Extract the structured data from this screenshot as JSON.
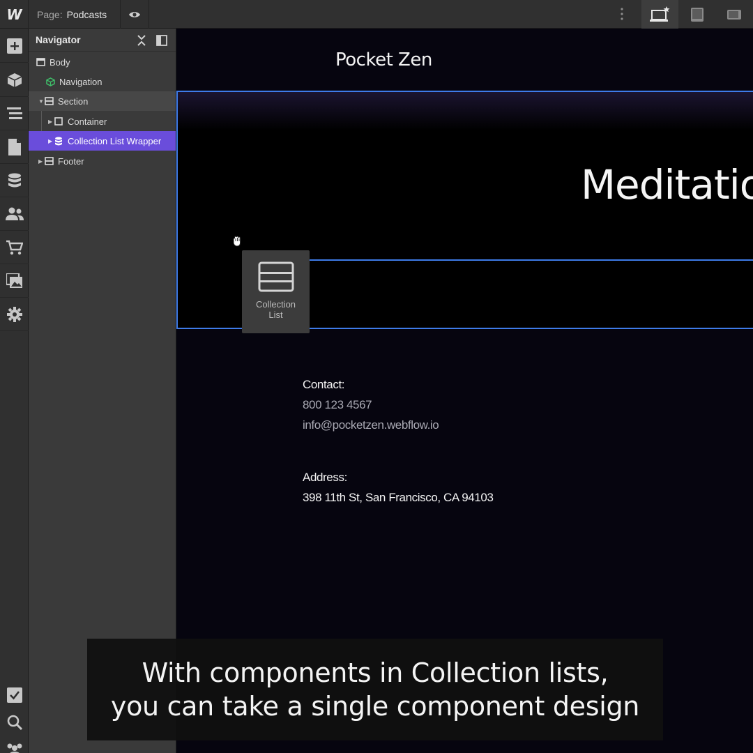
{
  "topbar": {
    "logo": "W",
    "page_prefix": "Page:",
    "page_name": "Podcasts",
    "icons": [
      "eye-icon",
      "kebab-menu-icon"
    ],
    "devices": [
      "desktop-star-icon",
      "tablet-icon",
      "tablet-landscape-icon"
    ]
  },
  "rail": {
    "items": [
      "add-icon",
      "components-icon",
      "navigator-icon",
      "pages-icon",
      "cms-icon",
      "users-icon",
      "ecommerce-icon",
      "assets-icon",
      "settings-icon"
    ],
    "bottom": [
      "checklist-icon",
      "search-icon",
      "team-icon"
    ]
  },
  "navigator": {
    "title": "Navigator",
    "tree": [
      {
        "label": "Body"
      },
      {
        "label": "Navigation"
      },
      {
        "label": "Section"
      },
      {
        "label": "Container"
      },
      {
        "label": "Collection List Wrapper"
      },
      {
        "label": "Footer"
      }
    ]
  },
  "canvas": {
    "brand": "Pocket Zen",
    "hero": "Meditatio",
    "drag_card": {
      "line1": "Collection",
      "line2": "List"
    },
    "contact": {
      "heading": "Contact:",
      "phone": "800 123 4567",
      "email": "info@pocketzen.webflow.io"
    },
    "address": {
      "heading": "Address:",
      "line": "398 11th St, San Francisco, CA 94103"
    }
  },
  "caption": {
    "line1": "With components in Collection lists,",
    "line2": "you can take a single component design"
  },
  "colors": {
    "accent_purple": "#6a4ddb",
    "selection_blue": "#3e7be8",
    "component_green": "#3fbf6a",
    "canvas_bg": "#06050f"
  }
}
